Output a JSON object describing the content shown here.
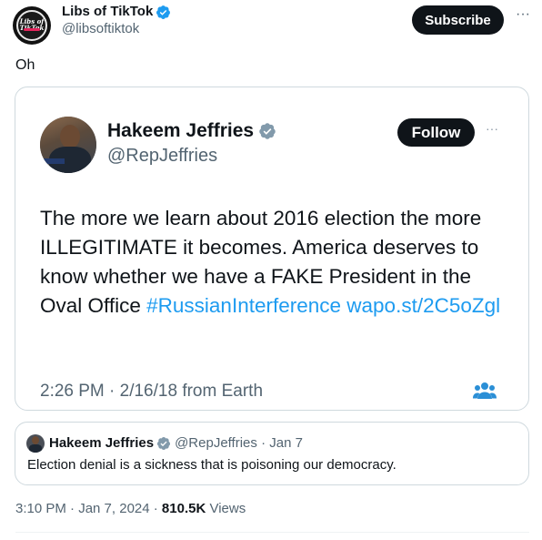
{
  "post": {
    "author_name": "Libs of TikTok",
    "handle": "@libsoftiktok",
    "avatar_logo_text": "Libs of TikTok",
    "subscribe_label": "Subscribe",
    "more_label": "···",
    "text": "Oh",
    "timestamp": "3:10 PM · Jan 7, 2024 · ",
    "views_count": "810.5K",
    "views_label": " Views"
  },
  "screenshot_tweet": {
    "author_name": "Hakeem Jeffries",
    "handle": "@RepJeffries",
    "follow_label": "Follow",
    "more_label": "···",
    "text_before": "The more we learn about 2016 election the more ILLEGITIMATE it becomes. America deserves to know whether we have a FAKE President in the Oval Office ",
    "hashtag": "#RussianInterference",
    "link": "wapo.st/​2C5oZgl",
    "meta": "2:26 PM · 2/16/18 from Earth",
    "people_icon": "people-icon"
  },
  "quoted_post": {
    "author_name": "Hakeem Jeffries",
    "handle_date": "@RepJeffries · Jan 7",
    "text": "Election denial is a sickness that is poisoning our democracy."
  },
  "colors": {
    "verified_blue": "#1d9bf0",
    "link_blue": "#1d9bf0",
    "secondary_text": "#536471",
    "button_dark": "#0f1419",
    "border": "#cfd9de"
  }
}
